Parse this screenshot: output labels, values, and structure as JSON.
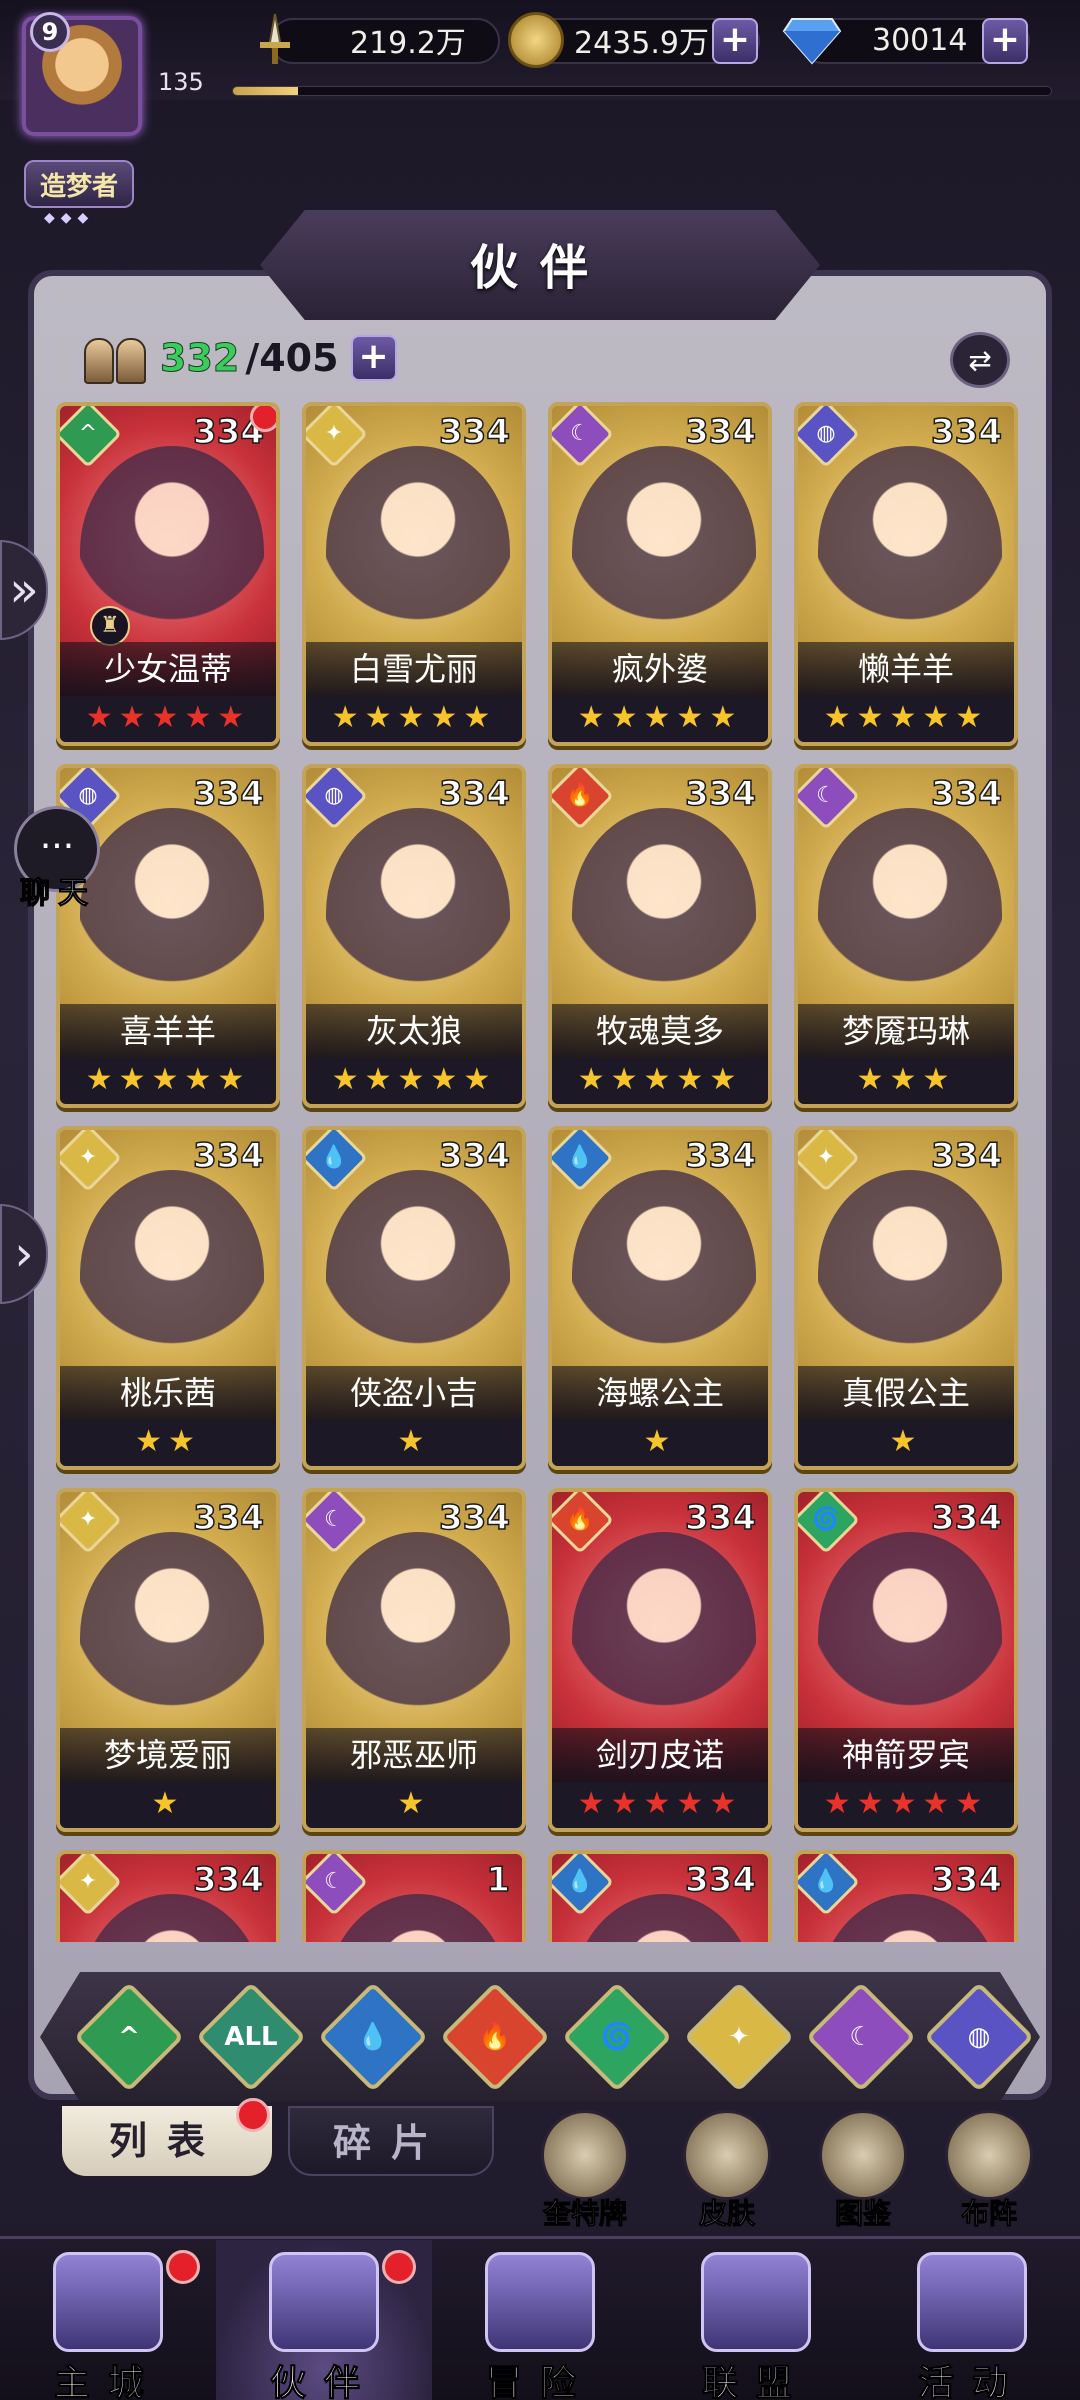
{
  "player": {
    "level": "9",
    "title": "造梦者",
    "exp_value": "135",
    "exp_progress": 0.08
  },
  "resources": {
    "power": "219.2万",
    "gold": "2435.9万",
    "diamond": "30014"
  },
  "header": {
    "title": "伙伴"
  },
  "partners": {
    "owned": "332",
    "total": "/405"
  },
  "cards": [
    {
      "name": "少女温蒂",
      "level": "334",
      "element": "forest",
      "stars": "★★★★★",
      "star_color": "red",
      "bg": "red",
      "red_dot": true,
      "lock": true
    },
    {
      "name": "白雪尤丽",
      "level": "334",
      "element": "light",
      "stars": "★★★★★",
      "star_color": "gold",
      "bg": "gold"
    },
    {
      "name": "疯外婆",
      "level": "334",
      "element": "dark",
      "stars": "★★★★★",
      "star_color": "gold",
      "bg": "gold"
    },
    {
      "name": "懒羊羊",
      "level": "334",
      "element": "space",
      "stars": "★★★★★",
      "star_color": "gold",
      "bg": "gold"
    },
    {
      "name": "喜羊羊",
      "level": "334",
      "element": "space",
      "stars": "★★★★★",
      "star_color": "gold",
      "bg": "gold"
    },
    {
      "name": "灰太狼",
      "level": "334",
      "element": "space",
      "stars": "★★★★★",
      "star_color": "gold",
      "bg": "gold"
    },
    {
      "name": "牧魂莫多",
      "level": "334",
      "element": "fire",
      "stars": "★★★★★",
      "star_color": "gold",
      "bg": "gold"
    },
    {
      "name": "梦魇玛琳",
      "level": "334",
      "element": "dark",
      "stars": "★★★",
      "star_color": "gold",
      "bg": "gold"
    },
    {
      "name": "桃乐茜",
      "level": "334",
      "element": "light",
      "stars": "★★",
      "star_color": "gold",
      "bg": "gold"
    },
    {
      "name": "侠盗小吉",
      "level": "334",
      "element": "water",
      "stars": "★",
      "star_color": "gold",
      "bg": "gold"
    },
    {
      "name": "海螺公主",
      "level": "334",
      "element": "water",
      "stars": "★",
      "star_color": "gold",
      "bg": "gold"
    },
    {
      "name": "真假公主",
      "level": "334",
      "element": "light",
      "stars": "★",
      "star_color": "gold",
      "bg": "gold"
    },
    {
      "name": "梦境爱丽",
      "level": "334",
      "element": "light",
      "stars": "★",
      "star_color": "gold",
      "bg": "gold"
    },
    {
      "name": "邪恶巫师",
      "level": "334",
      "element": "dark",
      "stars": "★",
      "star_color": "gold",
      "bg": "gold"
    },
    {
      "name": "剑刃皮诺",
      "level": "334",
      "element": "fire",
      "stars": "★★★★★",
      "star_color": "red",
      "bg": "red"
    },
    {
      "name": "神箭罗宾",
      "level": "334",
      "element": "wind",
      "stars": "★★★★★",
      "star_color": "red",
      "bg": "red"
    },
    {
      "name": "",
      "level": "334",
      "element": "light",
      "stars": "",
      "star_color": "gold",
      "bg": "red"
    },
    {
      "name": "",
      "level": "1",
      "element": "dark",
      "stars": "",
      "star_color": "gold",
      "bg": "red"
    },
    {
      "name": "",
      "level": "334",
      "element": "water",
      "stars": "",
      "star_color": "gold",
      "bg": "red"
    },
    {
      "name": "",
      "level": "334",
      "element": "water",
      "stars": "",
      "star_color": "gold",
      "bg": "red"
    }
  ],
  "filters": [
    {
      "id": "forest",
      "label": "^"
    },
    {
      "id": "all",
      "label": "ALL"
    },
    {
      "id": "water",
      "label": "💧"
    },
    {
      "id": "fire",
      "label": "🔥"
    },
    {
      "id": "wind",
      "label": "🌀"
    },
    {
      "id": "light",
      "label": "✦"
    },
    {
      "id": "dark",
      "label": "☾"
    },
    {
      "id": "space",
      "label": "◍"
    }
  ],
  "tabs": {
    "list": "列表",
    "fragments": "碎片"
  },
  "quick_actions": [
    {
      "label": "奎特牌"
    },
    {
      "label": "皮肤"
    },
    {
      "label": "图鉴"
    },
    {
      "label": "布阵"
    }
  ],
  "side": {
    "chat_label": "聊天"
  },
  "nav": [
    {
      "label": "主城",
      "active": false,
      "dot": true
    },
    {
      "label": "伙伴",
      "active": true,
      "dot": true
    },
    {
      "label": "冒险",
      "active": false,
      "dot": false
    },
    {
      "label": "联盟",
      "active": false,
      "dot": false
    },
    {
      "label": "活动",
      "active": false,
      "dot": false
    }
  ],
  "colors": {
    "accent_purple": "#6d5aa5",
    "count_green": "#3acd5b",
    "star_gold": "#f7c52b",
    "star_red": "#e8322a",
    "notify_red": "#e4202a"
  }
}
